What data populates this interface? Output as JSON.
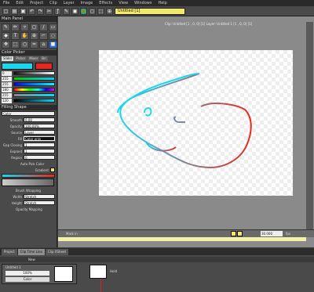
{
  "menu": [
    "File",
    "Edit",
    "Project",
    "Clip",
    "Layer",
    "Image",
    "Effects",
    "View",
    "Windows",
    "Help"
  ],
  "toolbar": {
    "dropdown": "Untitled [1]",
    "percent": "100%"
  },
  "main_panel": {
    "title": "Main Panel"
  },
  "info": {
    "text": "Project: 'Untitled (1)'  Clip: 'Untitled'  100.00%  0°  Current Layer: 'Untitled 1'  Current Image: 0"
  },
  "canvas_header": {
    "text": "Clip: Untitled [1 , 0, 0] [1]    Layer: Untitled 1 [1 , 0, 0] [1]"
  },
  "color_picker": {
    "title": "Color Picker",
    "tabs": [
      "Slider",
      "Picker",
      "Mixer",
      "Bri"
    ],
    "values": [
      "0",
      "255",
      "255",
      "180",
      "255",
      "120"
    ],
    "swatches": {
      "primary": "#18d8f0",
      "secondary": "#e52a1d"
    }
  },
  "fill_shape": {
    "title": "Filling Shape",
    "mode": "Color",
    "controls": [
      {
        "label": "Smooth",
        "value": "0.00"
      },
      {
        "label": "Opacity",
        "value": "100.00%"
      },
      {
        "label": "Source",
        "value": "Layer"
      },
      {
        "label": "Fill",
        "value": "Color only"
      },
      {
        "label": "Gap Closing",
        "value": "1"
      },
      {
        "label": "Expand",
        "value": "1"
      },
      {
        "label": "Region",
        "value": "0"
      }
    ],
    "auto_pick": "Auto Pick Color",
    "gradient_label": "Gradient",
    "wrapping_label": "Brush Wrapping",
    "width_label": "Width",
    "width_val": "Stretch",
    "height_label": "Height",
    "height_val": "Stretch",
    "opacity_mapping": "Opacity Mapping"
  },
  "playbar": {
    "mark_label": "Mark in",
    "frame": "30.000",
    "frame_label": "fps"
  },
  "bottom_tabs": [
    "Project",
    "Clip Time Line",
    "Clip XSheet"
  ],
  "timeline": {
    "new_label": "New",
    "layer_name": "Untitled 1",
    "percent": "100%",
    "color_label": "Color",
    "hold": "Hold"
  }
}
